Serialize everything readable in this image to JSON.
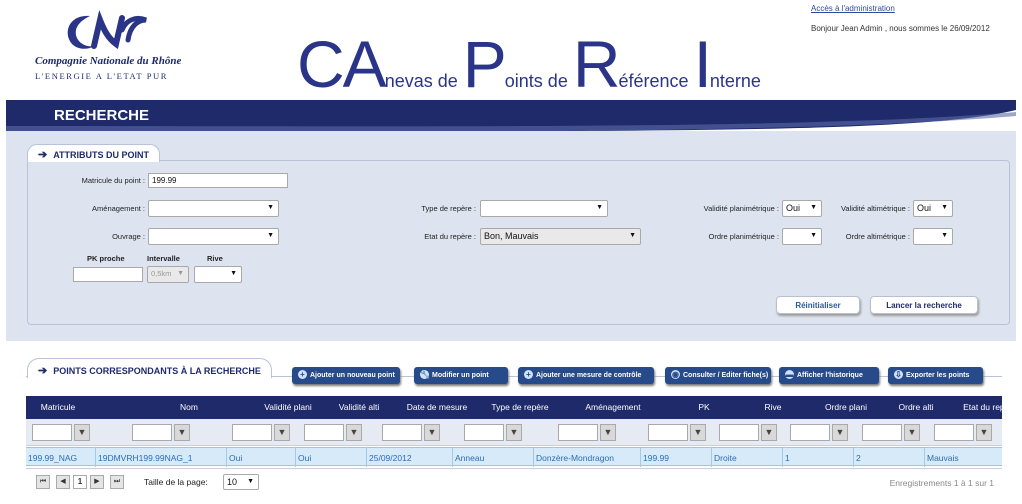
{
  "header": {
    "org_name": "Compagnie Nationale du Rhône",
    "org_tagline": "L'ENERGIE A L'ETAT PUR",
    "title_parts": [
      {
        "text": "CA",
        "big": true
      },
      {
        "text": "nevas de ",
        "big": false
      },
      {
        "text": "P",
        "big": true
      },
      {
        "text": "oints de ",
        "big": false
      },
      {
        "text": "R",
        "big": true
      },
      {
        "text": "éférence ",
        "big": false
      },
      {
        "text": "I",
        "big": true
      },
      {
        "text": "nterne",
        "big": false
      }
    ],
    "admin_link": "Accès à l'administration",
    "greeting": "Bonjour Jean Admin , nous sommes le 26/09/2012",
    "brand_color": "#1e2a6a"
  },
  "page": {
    "title": "RECHERCHE"
  },
  "attributes": {
    "section_title": "ATTRIBUTS DU POINT",
    "matricule_label": "Matricule du point :",
    "matricule_value": "199.99",
    "amenagement_label": "Aménagement :",
    "amenagement_value": "",
    "ouvrage_label": "Ouvrage :",
    "ouvrage_value": "",
    "pk_label": "PK proche",
    "intervalle_label": "Intervalle",
    "intervalle_value": "0,5km",
    "rive_label": "Rive",
    "rive_value": "",
    "type_repere_label": "Type de repère :",
    "type_repere_value": "",
    "etat_repere_label": "Etat du repère :",
    "etat_repere_value": "Bon, Mauvais",
    "val_plani_label": "Validité planimétrique :",
    "val_plani_value": "Oui",
    "val_alti_label": "Validité altimétrique :",
    "val_alti_value": "Oui",
    "ordre_plani_label": "Ordre planimétrique :",
    "ordre_plani_value": "",
    "ordre_alti_label": "Ordre altimétrique :",
    "ordre_alti_value": "",
    "reset_button": "Réinitialiser",
    "search_button": "Lancer la recherche"
  },
  "results": {
    "section_title": "POINTS CORRESPONDANTS À LA RECHERCHE",
    "actions": [
      {
        "label": "Ajouter un nouveau point",
        "icon": "plus-icon"
      },
      {
        "label": "Modifier un point",
        "icon": "wrench-icon"
      },
      {
        "label": "Ajouter une mesure de contrôle",
        "icon": "plus-icon"
      },
      {
        "label": "Consulter / Editer fiche(s)",
        "icon": "eye-icon"
      },
      {
        "label": "Afficher l'historique",
        "icon": "folder-icon"
      },
      {
        "label": "Exporter les points",
        "icon": "download-icon"
      }
    ],
    "columns": [
      "Matricule",
      "Nom",
      "Validité plani",
      "Validité alti",
      "Date de mesure",
      "Type de repère",
      "Aménagement",
      "PK",
      "Rive",
      "Ordre plani",
      "Ordre alti",
      "Etat du repère"
    ],
    "rows": [
      [
        "199.99_NAG",
        "19DMVRH199.99NAG_1",
        "Oui",
        "Oui",
        "25/09/2012",
        "Anneau",
        "Donzère-Mondragon",
        "199.99",
        "Droite",
        "1",
        "2",
        "Mauvais"
      ]
    ],
    "page_size_label": "Taille de la page:",
    "page_size": "10",
    "current_page": "1",
    "records_info": "Enregistrements 1 à 1 sur 1"
  }
}
